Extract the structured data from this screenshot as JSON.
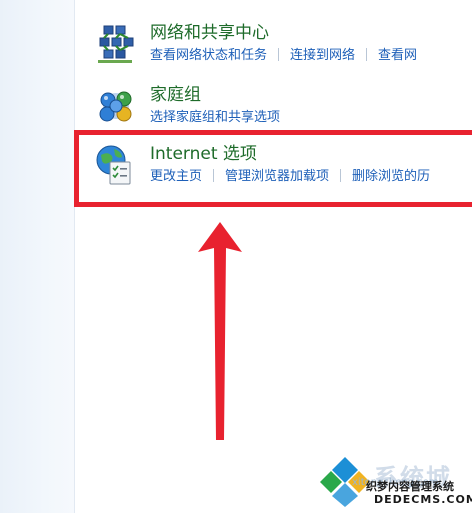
{
  "categories": [
    {
      "title": "网络和共享中心",
      "icon": "network-icon",
      "links": [
        "查看网络状态和任务",
        "连接到网络",
        "查看网"
      ]
    },
    {
      "title": "家庭组",
      "icon": "homegroup-icon",
      "links": [
        "选择家庭组和共享选项"
      ]
    },
    {
      "title": "Internet 选项",
      "icon": "internet-options-icon",
      "links": [
        "更改主页",
        "管理浏览器加载项",
        "删除浏览的历"
      ]
    }
  ],
  "annotation": {
    "highlight_color": "#e8222f",
    "arrow_color": "#e8222f"
  },
  "watermark": {
    "brand": "系统城",
    "url_small": "xitongcheng.com",
    "cn_text": "织梦内容管理系统",
    "url": "DEDECMS.COM"
  },
  "colors": {
    "title_green": "#1e6b2a",
    "link_blue": "#1d5fb8"
  }
}
